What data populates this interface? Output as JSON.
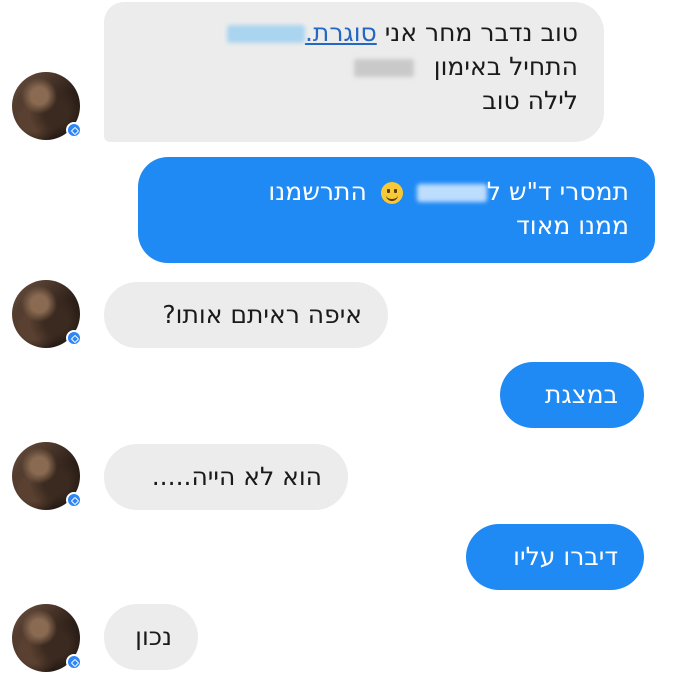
{
  "messages": [
    {
      "direction": "incoming",
      "lines": [
        {
          "text": "טוב נדבר מחר אני",
          "link": "סוגרת."
        },
        {
          "text": "התחיל באימון"
        },
        {
          "text": "לילה טוב"
        }
      ]
    },
    {
      "direction": "outgoing",
      "lines": [
        {
          "before": "תמסרי ד\"ש ל",
          "after": "התרשמנו"
        },
        {
          "text": "ממנו מאוד"
        }
      ]
    },
    {
      "direction": "incoming",
      "text": "איפה ראיתם אותו?"
    },
    {
      "direction": "outgoing",
      "text": "במצגת"
    },
    {
      "direction": "incoming",
      "text": "הוא לא הייה....."
    },
    {
      "direction": "outgoing",
      "text": "דיברו עליו"
    },
    {
      "direction": "incoming",
      "text": "נכון"
    }
  ],
  "icons": {
    "avatar": "contact-avatar",
    "active_badge": "messenger-active-badge-icon",
    "emoji": "smiley-face-emoji-icon"
  },
  "colors": {
    "incoming_bubble": "#ececec",
    "outgoing_bubble": "#1f8af4",
    "link": "#2468c4"
  }
}
